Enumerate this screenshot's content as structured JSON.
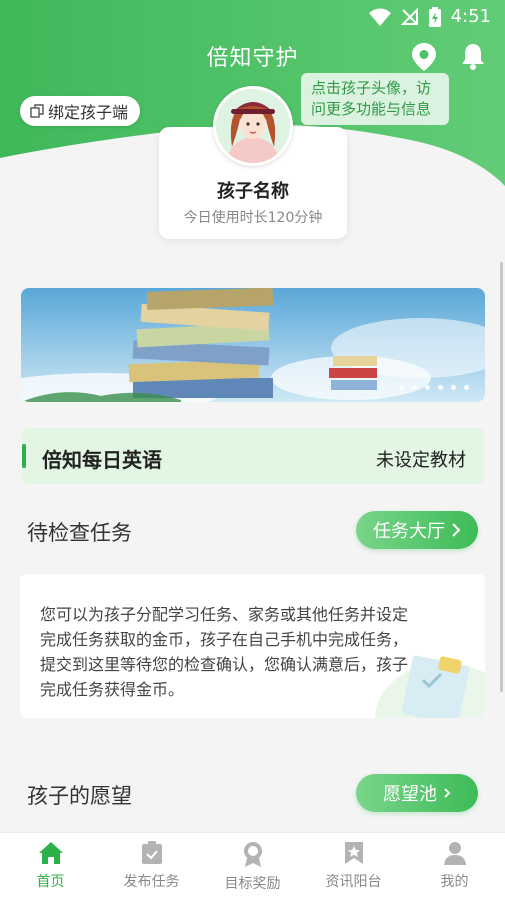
{
  "status_bar": {
    "time": "4:51"
  },
  "header": {
    "title": "倍知守护",
    "bind_button": "绑定孩子端",
    "tooltip": "点击孩子头像，访问更多功能与信息"
  },
  "child": {
    "name": "孩子名称",
    "usage": "今日使用时长120分钟"
  },
  "banner": {
    "dot_count": 6
  },
  "english": {
    "title": "倍知每日英语",
    "status": "未设定教材"
  },
  "tasks": {
    "title": "待检查任务",
    "hall_button": "任务大厅",
    "description": "您可以为孩子分配学习任务、家务或其他任务并设定完成任务获取的金币，孩子在自己手机中完成任务，提交到这里等待您的检查确认，您确认满意后，孩子完成任务获得金币。"
  },
  "wishes": {
    "title": "孩子的愿望",
    "pool_button": "愿望池"
  },
  "nav": {
    "items": [
      {
        "label": "首页",
        "icon": "home-icon",
        "active": true
      },
      {
        "label": "发布任务",
        "icon": "clipboard-check-icon",
        "active": false
      },
      {
        "label": "目标奖励",
        "icon": "medal-icon",
        "active": false
      },
      {
        "label": "资讯阳台",
        "icon": "bookmark-star-icon",
        "active": false
      },
      {
        "label": "我的",
        "icon": "person-icon",
        "active": false
      }
    ]
  },
  "colors": {
    "brand_green": "#2bb04a",
    "header_green": "#4cc165"
  }
}
